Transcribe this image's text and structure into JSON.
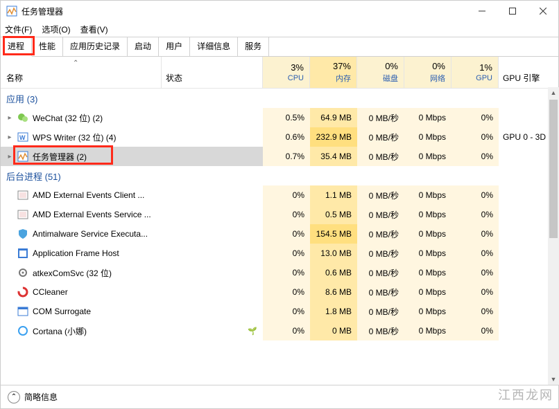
{
  "window": {
    "title": "任务管理器"
  },
  "menu": {
    "file": "文件(F)",
    "options": "选项(O)",
    "view": "查看(V)"
  },
  "tabs": [
    "进程",
    "性能",
    "应用历史记录",
    "启动",
    "用户",
    "详细信息",
    "服务"
  ],
  "columns": {
    "name": "名称",
    "status": "状态",
    "cpu": {
      "pct": "3%",
      "label": "CPU"
    },
    "mem": {
      "pct": "37%",
      "label": "内存"
    },
    "disk": {
      "pct": "0%",
      "label": "磁盘"
    },
    "net": {
      "pct": "0%",
      "label": "网络"
    },
    "gpu": {
      "pct": "1%",
      "label": "GPU"
    },
    "gpueng": "GPU 引擎"
  },
  "groups": {
    "apps": {
      "label": "应用 (3)"
    },
    "bg": {
      "label": "后台进程 (51)"
    }
  },
  "rows": [
    {
      "icon": "wechat",
      "name": "WeChat (32 位) (2)",
      "expandable": true,
      "cpu": "0.5%",
      "mem": "64.9 MB",
      "disk": "0 MB/秒",
      "net": "0 Mbps",
      "gpu": "0%",
      "eng": ""
    },
    {
      "icon": "wps",
      "name": "WPS Writer (32 位) (4)",
      "expandable": true,
      "cpu": "0.6%",
      "mem": "232.9 MB",
      "memhi": true,
      "disk": "0 MB/秒",
      "net": "0 Mbps",
      "gpu": "0%",
      "eng": "GPU 0 - 3D"
    },
    {
      "icon": "taskmgr",
      "name": "任务管理器 (2)",
      "expandable": true,
      "selected": true,
      "cpu": "0.7%",
      "mem": "35.4 MB",
      "disk": "0 MB/秒",
      "net": "0 Mbps",
      "gpu": "0%",
      "eng": ""
    },
    {
      "icon": "amd",
      "name": "AMD External Events Client ...",
      "cpu": "0%",
      "mem": "1.1 MB",
      "disk": "0 MB/秒",
      "net": "0 Mbps",
      "gpu": "0%",
      "eng": ""
    },
    {
      "icon": "amd",
      "name": "AMD External Events Service ...",
      "cpu": "0%",
      "mem": "0.5 MB",
      "disk": "0 MB/秒",
      "net": "0 Mbps",
      "gpu": "0%",
      "eng": ""
    },
    {
      "icon": "shield",
      "name": "Antimalware Service Executa...",
      "cpu": "0%",
      "mem": "154.5 MB",
      "memhi": true,
      "disk": "0 MB/秒",
      "net": "0 Mbps",
      "gpu": "0%",
      "eng": ""
    },
    {
      "icon": "appframe",
      "name": "Application Frame Host",
      "cpu": "0%",
      "mem": "13.0 MB",
      "disk": "0 MB/秒",
      "net": "0 Mbps",
      "gpu": "0%",
      "eng": ""
    },
    {
      "icon": "gear",
      "name": "atkexComSvc (32 位)",
      "cpu": "0%",
      "mem": "0.6 MB",
      "disk": "0 MB/秒",
      "net": "0 Mbps",
      "gpu": "0%",
      "eng": ""
    },
    {
      "icon": "ccleaner",
      "name": "CCleaner",
      "cpu": "0%",
      "mem": "8.6 MB",
      "disk": "0 MB/秒",
      "net": "0 Mbps",
      "gpu": "0%",
      "eng": ""
    },
    {
      "icon": "com",
      "name": "COM Surrogate",
      "cpu": "0%",
      "mem": "1.8 MB",
      "disk": "0 MB/秒",
      "net": "0 Mbps",
      "gpu": "0%",
      "eng": ""
    },
    {
      "icon": "cortana",
      "name": "Cortana (小娜)",
      "leaf": true,
      "cpu": "0%",
      "mem": "0 MB",
      "disk": "0 MB/秒",
      "net": "0 Mbps",
      "gpu": "0%",
      "eng": ""
    }
  ],
  "statusbar": {
    "label": "简略信息"
  },
  "watermark": "江西龙网"
}
